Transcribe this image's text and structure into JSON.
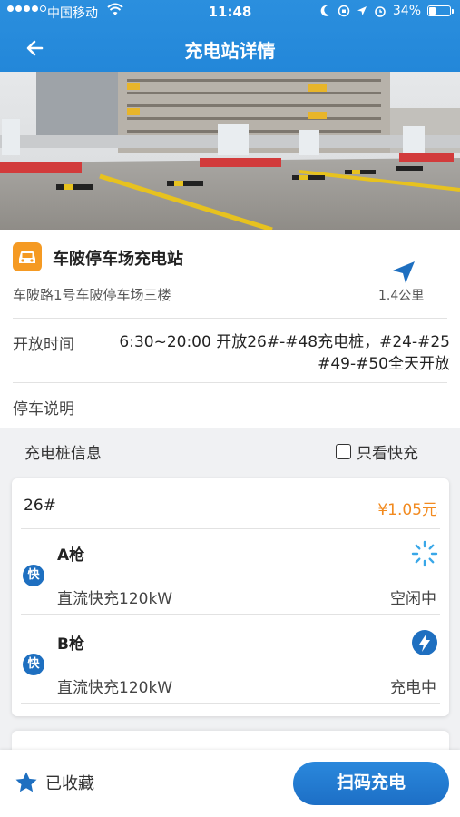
{
  "status_bar": {
    "carrier": "中国移动",
    "time": "11:48",
    "battery_text": "34%",
    "battery_level": 0.34
  },
  "nav": {
    "title": "充电站详情"
  },
  "station": {
    "name": "车陂停车场充电站",
    "address": "车陂路1号车陂停车场三楼",
    "distance": "1.4公里",
    "hours_label": "开放时间",
    "hours_line1": "6:30~20:00 开放26#-#48充电桩，#24-#25",
    "hours_line2": "#49-#50全天开放",
    "parking_label": "停车说明"
  },
  "charger_section": {
    "title": "充电桩信息",
    "fast_only_label": "只看快充",
    "fast_only_checked": false
  },
  "piles": [
    {
      "number": "26#",
      "price": "¥1.05元",
      "guns": [
        {
          "badge": "快",
          "name": "A枪",
          "spec": "直流快充120kW",
          "status": "空闲中",
          "icon": "idle-spinner-icon"
        },
        {
          "badge": "快",
          "name": "B枪",
          "spec": "直流快充120kW",
          "status": "充电中",
          "icon": "lightning-icon"
        }
      ]
    }
  ],
  "bottom_bar": {
    "favorite_label": "已收藏",
    "scan_label": "扫码充电"
  },
  "colors": {
    "primary": "#2387d9",
    "price": "#f28a1f",
    "station_icon": "#f59a23",
    "badge": "#1e6fc0"
  }
}
